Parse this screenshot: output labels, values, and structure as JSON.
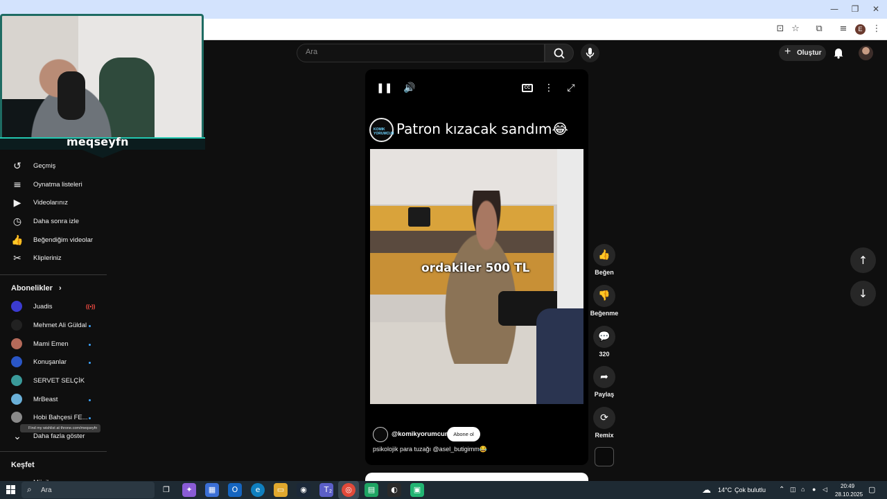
{
  "window": {
    "minimize": "—",
    "restore": "❐",
    "close": "✕"
  },
  "browser_icons": {
    "cast": "⊡",
    "star": "☆",
    "extensions": "⧉",
    "media": "≡",
    "profile": "E",
    "menu": "⋮"
  },
  "header": {
    "search_placeholder": "Ara",
    "create_label": "Oluştur",
    "search_icon": "⌕",
    "mic_icon": "🎤",
    "bell_icon": "🔔"
  },
  "streamer": {
    "name": "meqseyfn",
    "tooltip": "Find my wishlist at throne.com/meqseyfn"
  },
  "sidebar": {
    "items": [
      {
        "icon": "↺",
        "label": "Geçmiş"
      },
      {
        "icon": "≡",
        "label": "Oynatma listeleri"
      },
      {
        "icon": "▶",
        "label": "Videolarınız"
      },
      {
        "icon": "◷",
        "label": "Daha sonra izle"
      },
      {
        "icon": "👍",
        "label": "Beğendiğim videolar"
      },
      {
        "icon": "✂",
        "label": "Klipleriniz"
      }
    ],
    "subs_heading": "Abonelikler",
    "subs_chevron": "›",
    "subscriptions": [
      {
        "name": "Juadis",
        "status": "live",
        "color": "#3b3bd0"
      },
      {
        "name": "Mehmet Ali Güldal",
        "status": "new",
        "color": "#222222"
      },
      {
        "name": "Mami Emen",
        "status": "new",
        "color": "#b46a5a"
      },
      {
        "name": "Konuşanlar",
        "status": "new",
        "color": "#2a56c6"
      },
      {
        "name": "SERVET SELÇİK",
        "status": "none",
        "color": "#3a9a9a"
      },
      {
        "name": "MrBeast",
        "status": "new",
        "color": "#6ab0d8"
      },
      {
        "name": "Hobi Bahçesi FE...",
        "status": "new",
        "color": "#8a8a8a"
      }
    ],
    "live_badge": "((•))",
    "more_label": "Daha fazla göster",
    "more_icon": "⌄",
    "explore_heading": "Keşfet",
    "partial_item": "Müzik"
  },
  "player": {
    "pause_icon": "❚❚",
    "volume_icon": "🔊",
    "cc_label": "CC",
    "more_icon": "⋮",
    "fullscreen_icon": "⤢",
    "title": "Patron kızacak sandım😂",
    "channel_badge": "KOMIK YORUMCUN",
    "caption": "ordakiler 500 TL",
    "handle": "@komikyorumcun",
    "subscribe_label": "Abone ol",
    "description": "psikolojik para tuzağı @asel_butigimm😂"
  },
  "actions": [
    {
      "icon": "👍",
      "label": "Beğen"
    },
    {
      "icon": "👎",
      "label": "Beğenme"
    },
    {
      "icon": "💬",
      "label": "320"
    },
    {
      "icon": "➦",
      "label": "Paylaş"
    },
    {
      "icon": "⟳",
      "label": "Remix"
    }
  ],
  "nav": {
    "up_icon": "↑",
    "down_icon": "↓"
  },
  "taskbar": {
    "search_placeholder": "Ara",
    "weather_temp": "14°C",
    "weather_text": "Çok bulutlu",
    "time": "20:49",
    "date": "28.10.2025",
    "teams_badge": "2"
  }
}
